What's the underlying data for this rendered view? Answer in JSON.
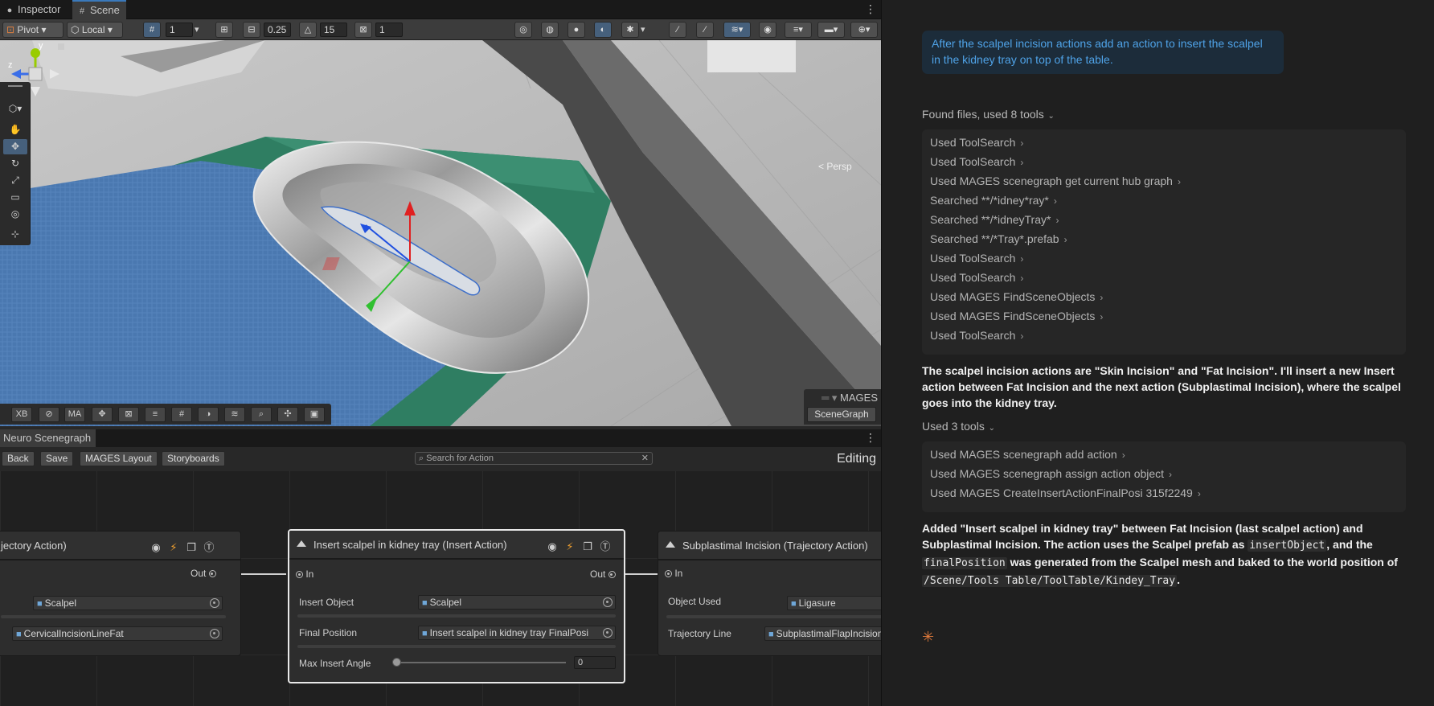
{
  "tabs": {
    "inspector": "Inspector",
    "scene": "Scene"
  },
  "toolbar": {
    "pivot": "Pivot",
    "local": "Local",
    "grid_value": "1",
    "snap_move": "0.25",
    "snap_rotate": "15",
    "snap_scale": "1"
  },
  "viewport": {
    "persp_label": "< Persp",
    "gizmo_axis_z": "z",
    "gizmo_axis_y": "y"
  },
  "bottom_overlay": {
    "xb": "XB",
    "ma": "MA"
  },
  "mages_overlay": {
    "title": "MAGES",
    "button": "SceneGraph"
  },
  "scenegraph": {
    "tab": "Neuro Scenegraph",
    "back": "Back",
    "save": "Save",
    "layout": "MAGES Layout",
    "storyboards": "Storyboards",
    "search_placeholder": "Search for Action",
    "mode": "Editing",
    "nodes": {
      "left": {
        "title": "jectory Action)",
        "out": "Out",
        "field1_value": "Scalpel",
        "field2_value": "CervicalIncisionLineFat"
      },
      "center": {
        "title": "Insert scalpel in kidney tray (Insert Action)",
        "in": "In",
        "out": "Out",
        "insert_object_label": "Insert Object",
        "insert_object_value": "Scalpel",
        "final_position_label": "Final Position",
        "final_position_value": "Insert scalpel in kidney tray FinalPosi",
        "max_angle_label": "Max Insert Angle",
        "max_angle_value": "0"
      },
      "right": {
        "title": "Subplastimal Incision (Trajectory Action)",
        "in": "In",
        "object_used_label": "Object Used",
        "object_used_value": "Ligasure",
        "trajectory_line_label": "Trajectory Line",
        "trajectory_line_value": "SubplastimalFlapIncision"
      }
    }
  },
  "chat": {
    "user_message": "After the scalpel incision actions add an action to insert the scalpel in the kidney tray on top of the table.",
    "section1": "Found files, used 8 tools",
    "tools1": [
      "Used ToolSearch",
      "Used ToolSearch",
      "Used MAGES scenegraph get current hub graph",
      "Searched **/*idney*ray*",
      "Searched **/*idneyTray*",
      "Searched **/*Tray*.prefab",
      "Used ToolSearch",
      "Used ToolSearch",
      "Used MAGES FindSceneObjects",
      "Used MAGES FindSceneObjects",
      "Used ToolSearch"
    ],
    "assistant1": "The scalpel incision actions are \"Skin Incision\" and \"Fat Incision\". I'll insert a new Insert action between Fat Incision and the next action (Subplastimal Incision), where the scalpel goes into the kidney tray.",
    "section2": "Used 3 tools",
    "tools2": [
      "Used MAGES scenegraph add action",
      "Used MAGES scenegraph assign action object",
      "Used MAGES CreateInsertActionFinalPosi 315f2249"
    ],
    "assistant2": {
      "p1": "Added \"Insert scalpel in kidney tray\" between Fat Incision (last scalpel action) and Subplastimal Incision. The action uses the Scalpel prefab as ",
      "code1": "insertObject",
      "p2": ", and the ",
      "code2": "finalPosition",
      "p3": " was generated from the Scalpel mesh and baked to the world position of ",
      "code3": "/Scene/Tools Table/ToolTable/Kindey_Tray",
      "p4": "."
    },
    "status_icon": "sparkle-icon"
  }
}
